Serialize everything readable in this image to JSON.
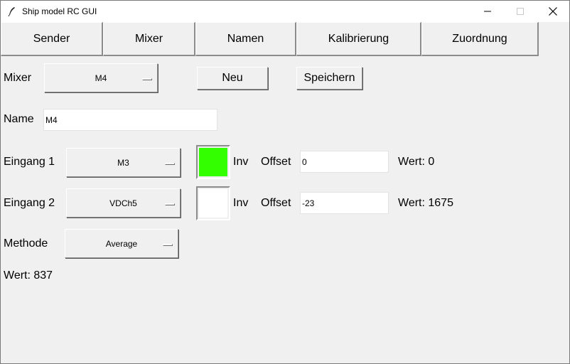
{
  "window": {
    "title": "Ship model RC GUI",
    "icons": [
      "feather-icon",
      "minimize-icon",
      "maximize-icon",
      "close-icon"
    ]
  },
  "tabs": [
    "Sender",
    "Mixer",
    "Namen",
    "Kalibrierung",
    "Zuordnung"
  ],
  "mixer": {
    "label": "Mixer",
    "selected": "M4",
    "new_button": "Neu",
    "save_button": "Speichern"
  },
  "name": {
    "label": "Name",
    "value": "M4"
  },
  "input1": {
    "label": "Eingang 1",
    "selected": "M3",
    "inv_label": "Inv",
    "inv_color": "#33ff00",
    "offset_label": "Offset",
    "offset_value": "0",
    "value_text": "Wert: 0"
  },
  "input2": {
    "label": "Eingang 2",
    "selected": "VDCh5",
    "inv_label": "Inv",
    "inv_color": "#ffffff",
    "offset_label": "Offset",
    "offset_value": "-23",
    "value_text": "Wert: 1675"
  },
  "method": {
    "label": "Methode",
    "selected": "Average"
  },
  "result": {
    "value_text": "Wert: 837"
  }
}
